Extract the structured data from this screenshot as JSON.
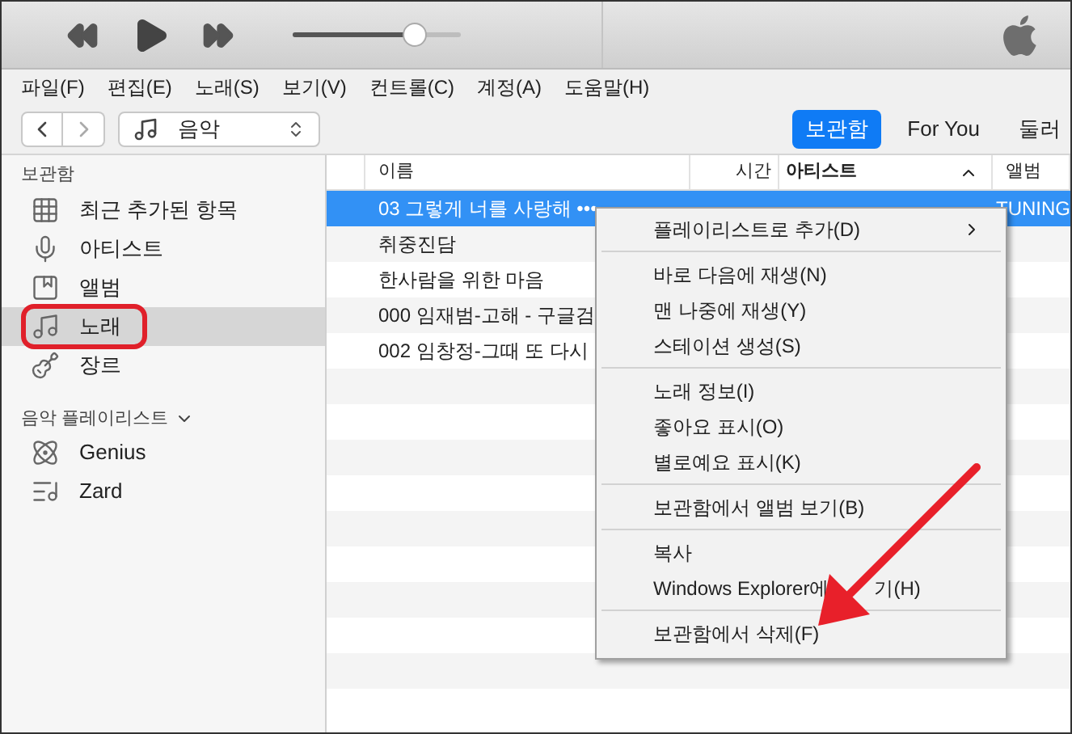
{
  "player": {
    "volume": {
      "level": 0.72
    }
  },
  "menu_bar": [
    "파일(F)",
    "편집(E)",
    "노래(S)",
    "보기(V)",
    "컨트롤(C)",
    "계정(A)",
    "도움말(H)"
  ],
  "nav": {
    "source": "음악",
    "tabs": [
      {
        "label": "보관함",
        "selected": true
      },
      {
        "label": "For You",
        "selected": false
      },
      {
        "label": "둘러",
        "selected": false
      }
    ]
  },
  "sidebar": {
    "section": "보관함",
    "items": [
      {
        "label": "최근 추가된 항목",
        "selected": false,
        "highlighted": false
      },
      {
        "label": "아티스트",
        "selected": false,
        "highlighted": false
      },
      {
        "label": "앨범",
        "selected": false,
        "highlighted": false
      },
      {
        "label": "노래",
        "selected": true,
        "highlighted": true
      },
      {
        "label": "장르",
        "selected": false,
        "highlighted": false
      }
    ],
    "playlists_header": "음악 플레이리스트",
    "playlists": [
      {
        "label": "Genius"
      },
      {
        "label": "Zard"
      }
    ]
  },
  "table": {
    "columns": [
      {
        "label": "이름",
        "sorted": false
      },
      {
        "label": "시간",
        "sorted": false
      },
      {
        "label": "아티스트",
        "sorted": true
      },
      {
        "label": "앨범",
        "sorted": false
      }
    ],
    "rows": [
      {
        "name": "03 그렇게 너를 사랑해 •••",
        "album": "TUNING",
        "selected": true
      },
      {
        "name": "취중진담",
        "album": "",
        "selected": false
      },
      {
        "name": "한사람을 위한 마음",
        "album": "",
        "selected": false
      },
      {
        "name": "000 임재범-고해 - 구글검",
        "album": "",
        "selected": false
      },
      {
        "name": "002 임창정-그때 또 다시",
        "album": "",
        "selected": false
      }
    ]
  },
  "context_menu": {
    "groups": [
      [
        {
          "label": "플레이리스트로 추가(D)",
          "submenu": true
        }
      ],
      [
        {
          "label": "바로 다음에 재생(N)",
          "submenu": false
        },
        {
          "label": "맨 나중에 재생(Y)",
          "submenu": false
        },
        {
          "label": "스테이션 생성(S)",
          "submenu": false
        }
      ],
      [
        {
          "label": "노래 정보(I)",
          "submenu": false
        },
        {
          "label": "좋아요 표시(O)",
          "submenu": false
        },
        {
          "label": "별로예요 표시(K)",
          "submenu": false
        }
      ],
      [
        {
          "label": "보관함에서 앨범 보기(B)",
          "submenu": false
        }
      ],
      [
        {
          "label": "복사",
          "submenu": false
        },
        {
          "label": "Windows Explorer에",
          "label_tail": "기(H)",
          "submenu": false
        }
      ],
      [
        {
          "label": "보관함에서 삭제(F)",
          "submenu": false
        }
      ]
    ]
  }
}
